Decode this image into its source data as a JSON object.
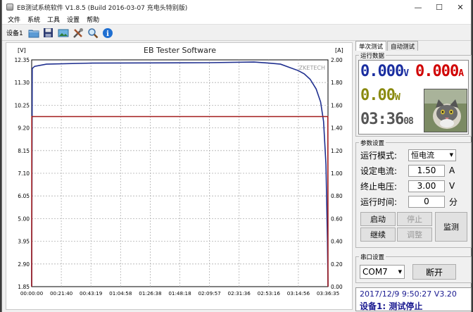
{
  "window": {
    "title": "EB测试系统软件 V1.8.5 (Build 2016-03-07 充电头特别版)",
    "minimize": "—",
    "maximize": "☐",
    "close": "✕"
  },
  "menu": [
    "文件",
    "系统",
    "工具",
    "设置",
    "帮助"
  ],
  "toolbar": {
    "device_label": "设备1"
  },
  "chart_data": {
    "type": "line",
    "title": "EB Tester Software",
    "watermark": "ZKETECH",
    "left_axis_unit": "[V]",
    "right_axis_unit": "[A]",
    "ylim_left": [
      1.85,
      12.35
    ],
    "ylim_right": [
      0.0,
      2.0
    ],
    "left_ticks": [
      "12.35",
      "11.30",
      "10.25",
      "9.20",
      "8.15",
      "7.10",
      "6.05",
      "5.00",
      "3.95",
      "2.90",
      "1.85"
    ],
    "right_ticks": [
      "2.00",
      "1.80",
      "1.60",
      "1.40",
      "1.20",
      "1.00",
      "0.80",
      "0.60",
      "0.40",
      "0.20",
      "0.00"
    ],
    "x_ticks": [
      "00:00:00",
      "00:21:40",
      "00:43:19",
      "01:04:58",
      "01:26:38",
      "01:48:18",
      "02:09:57",
      "02:31:36",
      "02:53:16",
      "03:14:56",
      "03:36:35"
    ],
    "series": [
      {
        "color": "#1f2f8f",
        "axis": "left",
        "points": [
          [
            0,
            1.85
          ],
          [
            0.2,
            11.95
          ],
          [
            1,
            12.05
          ],
          [
            5,
            12.15
          ],
          [
            20,
            12.2
          ],
          [
            60,
            12.22
          ],
          [
            75,
            12.25
          ],
          [
            80,
            12.2
          ],
          [
            84,
            12.15
          ],
          [
            87,
            12.0
          ],
          [
            90,
            11.85
          ],
          [
            92,
            11.7
          ],
          [
            94,
            11.45
          ],
          [
            96,
            11.0
          ],
          [
            97.5,
            10.4
          ],
          [
            98.5,
            9.5
          ],
          [
            99.3,
            7.5
          ],
          [
            99.8,
            4.0
          ],
          [
            100,
            1.85
          ]
        ]
      },
      {
        "color": "#a21c1c",
        "axis": "right",
        "points": [
          [
            0,
            0.0
          ],
          [
            0.05,
            1.5
          ],
          [
            99.95,
            1.5
          ],
          [
            100,
            0.0
          ]
        ]
      }
    ]
  },
  "panel": {
    "tab_single": "单次测试",
    "tab_auto": "自动测试",
    "run_data_title": "运行数据",
    "voltage": "0.000",
    "voltage_unit": "V",
    "current": "0.000",
    "current_unit": "A",
    "power": "0.00",
    "power_unit": "W",
    "time_main": "03:36",
    "time_sec": "08",
    "params_title": "参数设置",
    "mode_label": "运行模式:",
    "mode_value": "恒电流",
    "set_current_label": "设定电流:",
    "set_current_value": "1.50",
    "set_current_unit": "A",
    "end_voltage_label": "终止电压:",
    "end_voltage_value": "3.00",
    "end_voltage_unit": "V",
    "run_time_label": "运行时间:",
    "run_time_value": "0",
    "run_time_unit": "分",
    "btn_start": "启动",
    "btn_stop": "停止",
    "btn_continue": "继续",
    "btn_adjust": "调整",
    "btn_monitor": "监测",
    "serial_title": "串口设置",
    "com_port": "COM7",
    "btn_disconnect": "断开",
    "status_line1": "2017/12/9 9:50:27 V3.20",
    "status_line2": "设备1: 测试停止"
  },
  "colors": {
    "volt_blue": "#1a2ea0",
    "amp_red": "#d00000",
    "watt_olive": "#8a8a10",
    "time_gray": "#555555"
  }
}
